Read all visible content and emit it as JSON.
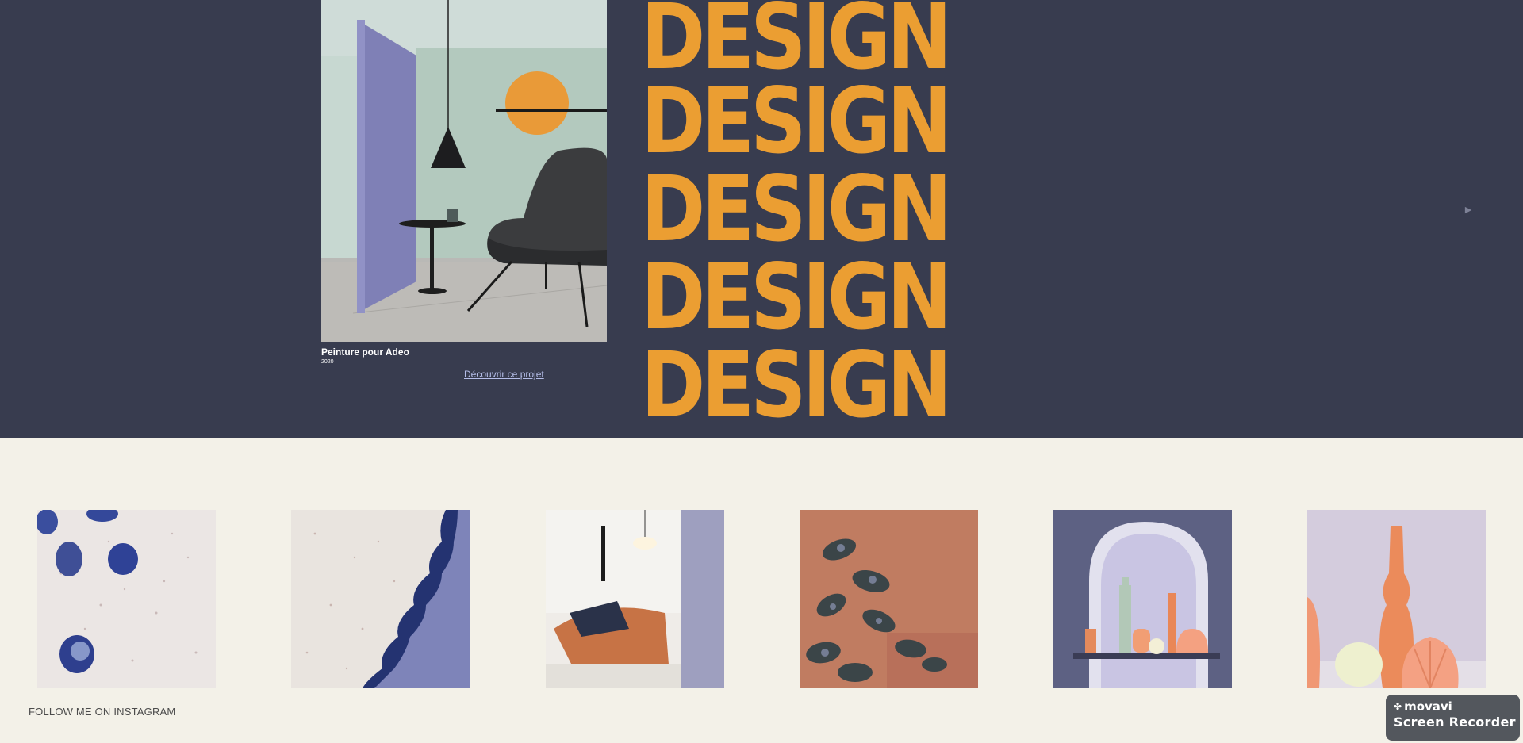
{
  "hero": {
    "project": {
      "title": "Peinture pour Adeo",
      "year": "2020",
      "link_label": "Découvrir ce projet",
      "image_icon": "lounge-chair-photo"
    },
    "design_words": [
      "DESIGN",
      "DESIGN",
      "DESIGN",
      "DESIGN",
      "DESIGN"
    ],
    "next_arrow": "►",
    "colors": {
      "background": "#383c4f",
      "accent": "#eb9e32",
      "link": "#b4bde8"
    }
  },
  "instagram": {
    "follow_label": "FOLLOW ME ON INSTAGRAM",
    "thumbnails": [
      {
        "icon": "blue-cups-terrazzo-photo"
      },
      {
        "icon": "terrazzo-wave-photo"
      },
      {
        "icon": "copper-bed-room-photo"
      },
      {
        "icon": "begonia-plant-photo"
      },
      {
        "icon": "arched-niche-vases-photo"
      },
      {
        "icon": "orange-vases-shell-photo"
      }
    ]
  },
  "recorder_badge": {
    "brand": "movavi",
    "product": "Screen Recorder"
  }
}
